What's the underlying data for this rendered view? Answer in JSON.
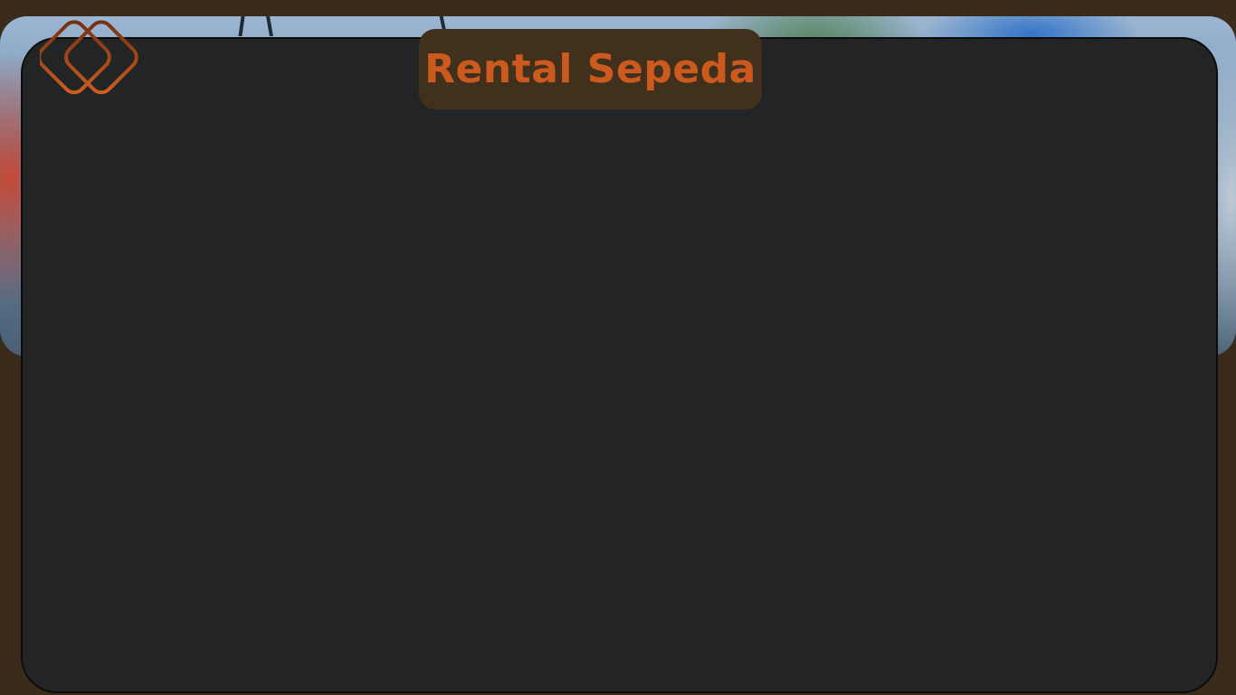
{
  "header": {
    "title": "Rental Sepeda"
  },
  "logo": {
    "icon": "diamond-logo-icon",
    "color": "#c85820"
  },
  "colors": {
    "page_background": "#3b2b1a",
    "panel_background": "#232426",
    "title_pill_background": "#40301c",
    "title_text": "#cc5a1e"
  }
}
